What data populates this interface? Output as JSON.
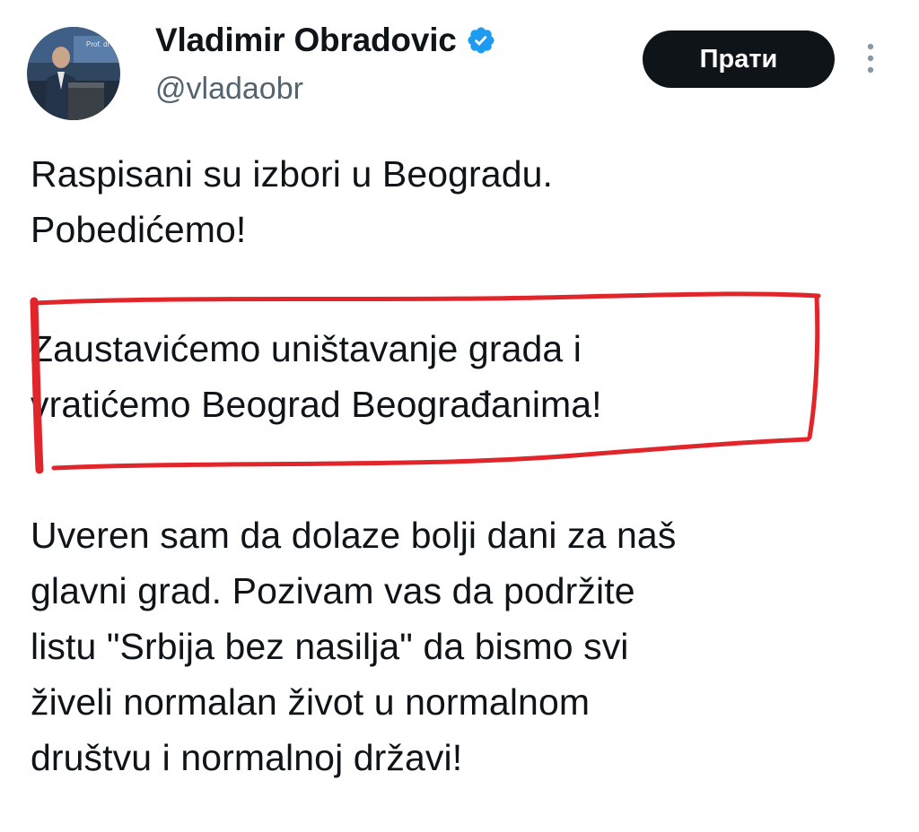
{
  "author": {
    "display_name": "Vladimir Obradovic",
    "handle": "@vladaobr",
    "verified": true,
    "avatar_banner_text": "Prof. dr Vlad..."
  },
  "actions": {
    "follow_label": "Прати",
    "more_icon": "vertical-ellipsis-icon"
  },
  "tweet": {
    "paragraph_1": [
      "Raspisani su izbori u Beogradu.",
      "Pobedićemo!"
    ],
    "paragraph_2": [
      "Zaustavićemo uništavanje grada i",
      "vratićemo Beograd Beograđanima!"
    ],
    "paragraph_3": [
      "Uveren sam da dolaze bolji dani za naš",
      "glavni grad. Pozivam vas da  podržite",
      "listu \"Srbija bez nasilja\" da bismo svi",
      "živeli normalan život u normalnom",
      "društvu i normalnoj državi!"
    ]
  },
  "colors": {
    "text": "#0f1419",
    "secondary_text": "#536471",
    "verified_badge": "#1d9bf0",
    "annotation_red": "#e0262b",
    "button_bg": "#0f1419"
  }
}
